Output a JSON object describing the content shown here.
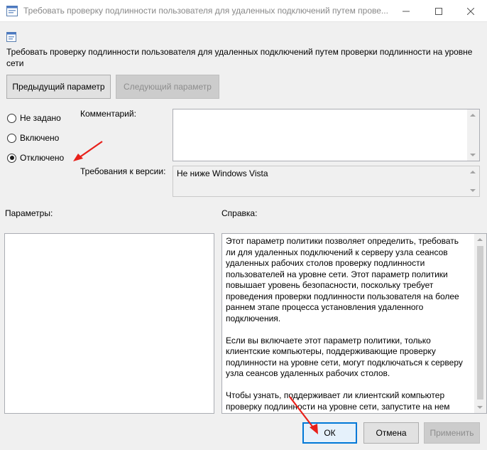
{
  "window": {
    "title": "Требовать проверку подлинности пользователя для удаленных подключений путем прове...",
    "minimize_icon": "minimize-icon",
    "maximize_icon": "maximize-icon",
    "close_icon": "close-icon"
  },
  "policy": {
    "title": "Требовать проверку подлинности пользователя для удаленных подключений путем проверки подлинности на уровне сети"
  },
  "nav": {
    "prev_label": "Предыдущий параметр",
    "next_label": "Следующий параметр"
  },
  "state": {
    "options": [
      "Не задано",
      "Включено",
      "Отключено"
    ],
    "selected": "Отключено"
  },
  "comment": {
    "label": "Комментарий:",
    "value": ""
  },
  "version": {
    "label": "Требования к версии:",
    "value": "Не ниже Windows Vista"
  },
  "params": {
    "label": "Параметры:"
  },
  "help": {
    "label": "Справка:",
    "text": "Этот параметр политики позволяет определить, требовать ли для удаленных подключений к серверу узла сеансов удаленных рабочих столов проверку подлинности пользователей на уровне сети. Этот параметр политики повышает уровень безопасности, поскольку требует проведения проверки подлинности пользователя на более раннем этапе процесса установления удаленного подключения.\n\nЕсли вы включаете этот параметр политики, только клиентские компьютеры, поддерживающие проверку подлинности на уровне сети, могут подключаться к серверу узла сеансов удаленных рабочих столов.\n\nЧтобы узнать, поддерживает ли клиентский компьютер проверку подлинности на уровне сети, запустите на нем"
  },
  "footer": {
    "ok_label": "ОК",
    "cancel_label": "Отмена",
    "apply_label": "Применить"
  },
  "colors": {
    "annotation_arrow": "#e8201a",
    "focus_border": "#0078d7"
  }
}
